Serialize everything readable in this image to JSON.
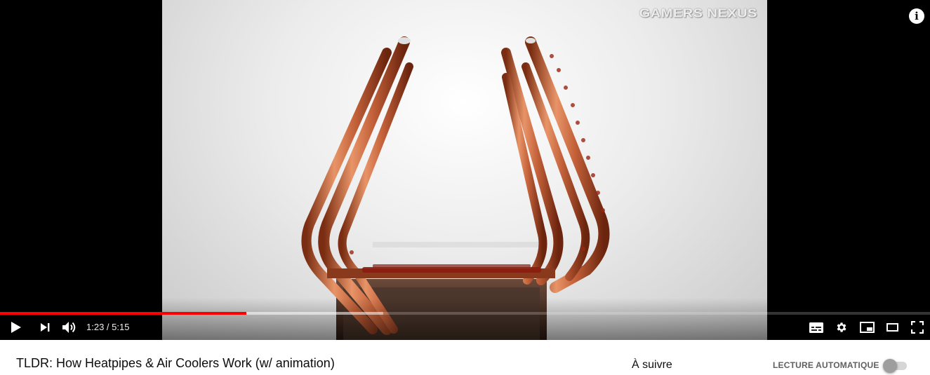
{
  "player": {
    "watermark": "GAMERS NEXUS",
    "info_icon": "info-icon",
    "time_current": "1:23",
    "time_separator": " / ",
    "time_total": "5:15",
    "played_fraction": 0.265,
    "loaded_fraction": 0.412,
    "progress_color": "#ff0000",
    "controls": {
      "play_icon": "play-icon",
      "next_icon": "next-icon",
      "volume_icon": "volume-icon",
      "subtitles_icon": "subtitles-icon",
      "settings_icon": "gear-icon",
      "miniplayer_icon": "miniplayer-icon",
      "theater_icon": "theater-icon",
      "fullscreen_icon": "fullscreen-icon"
    }
  },
  "video": {
    "title": "TLDR: How Heatpipes & Air Coolers Work (w/ animation)"
  },
  "sidebar": {
    "up_next": "À suivre",
    "autoplay_label": "LECTURE AUTOMATIQUE",
    "autoplay_on": false
  }
}
